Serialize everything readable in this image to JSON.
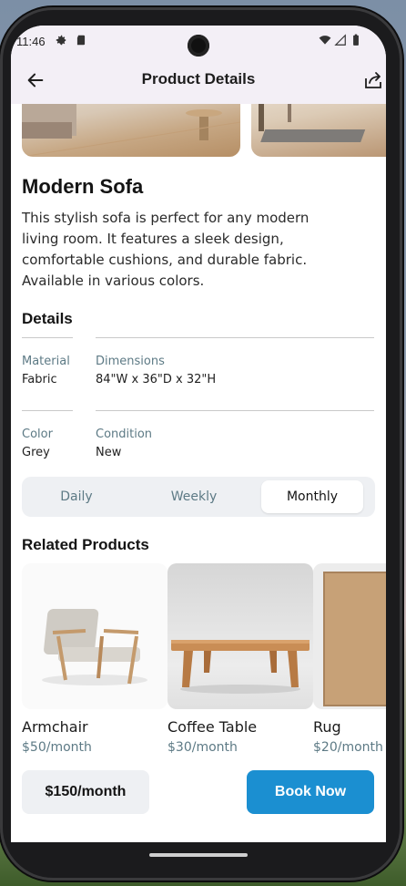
{
  "status_bar": {
    "time": "11:46"
  },
  "app_bar": {
    "title": "Product Details"
  },
  "product": {
    "name": "Modern Sofa",
    "description": "This stylish sofa is perfect for any modern living room. It features a sleek design, comfortable cushions, and durable fabric. Available in various colors."
  },
  "details": {
    "heading": "Details",
    "rows": [
      [
        {
          "label": "Material",
          "value": "Fabric"
        },
        {
          "label": "Dimensions",
          "value": "84\"W x 36\"D x 32\"H"
        }
      ],
      [
        {
          "label": "Color",
          "value": "Grey"
        },
        {
          "label": "Condition",
          "value": "New"
        }
      ]
    ]
  },
  "rental_period": {
    "options": [
      "Daily",
      "Weekly",
      "Monthly"
    ],
    "selected": "Monthly"
  },
  "related": {
    "heading": "Related Products",
    "items": [
      {
        "name": "Armchair",
        "price": "$50/month"
      },
      {
        "name": "Coffee Table",
        "price": "$30/month"
      },
      {
        "name": "Rug",
        "price": "$20/month"
      }
    ]
  },
  "footer": {
    "price": "$150/month",
    "book_label": "Book Now"
  },
  "colors": {
    "accent": "#1b8fd1",
    "muted_text": "#5d7a85",
    "appbar_bg": "#f3eff6",
    "segment_bg": "#eef0f3"
  }
}
